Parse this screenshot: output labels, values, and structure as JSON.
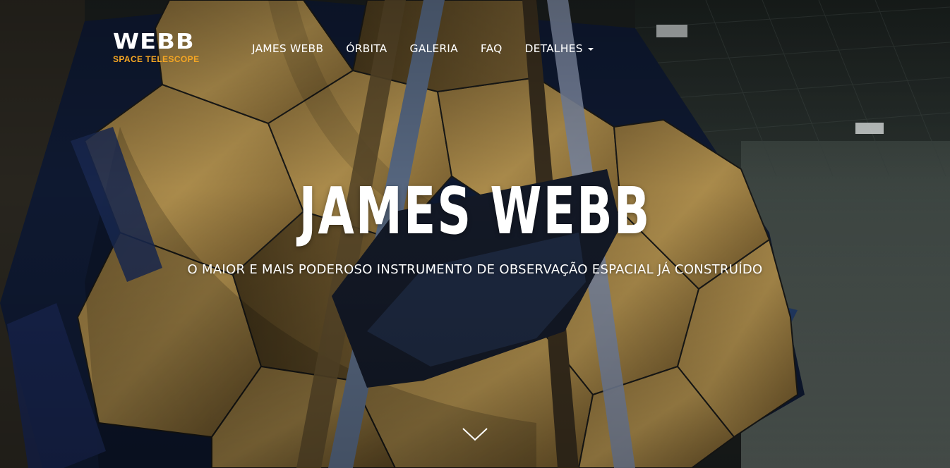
{
  "brand": {
    "name": "WEBB",
    "tagline": "SPACE TELESCOPE",
    "accent_color": "#f5a623"
  },
  "nav": {
    "items": [
      {
        "label": "JAMES WEBB"
      },
      {
        "label": "ÓRBITA"
      },
      {
        "label": "GALERIA"
      },
      {
        "label": "FAQ"
      },
      {
        "label": "DETALHES",
        "has_dropdown": true
      }
    ]
  },
  "hero": {
    "title": "JAMES WEBB",
    "subtitle": "O MAIOR E MAIS PODEROSO INSTRUMENTO DE OBSERVAÇÃO ESPACIAL JÁ CONSTRUÍDO",
    "scroll_icon": "chevron-down-icon",
    "background_image": "james-webb-telescope-mirror-photo"
  }
}
